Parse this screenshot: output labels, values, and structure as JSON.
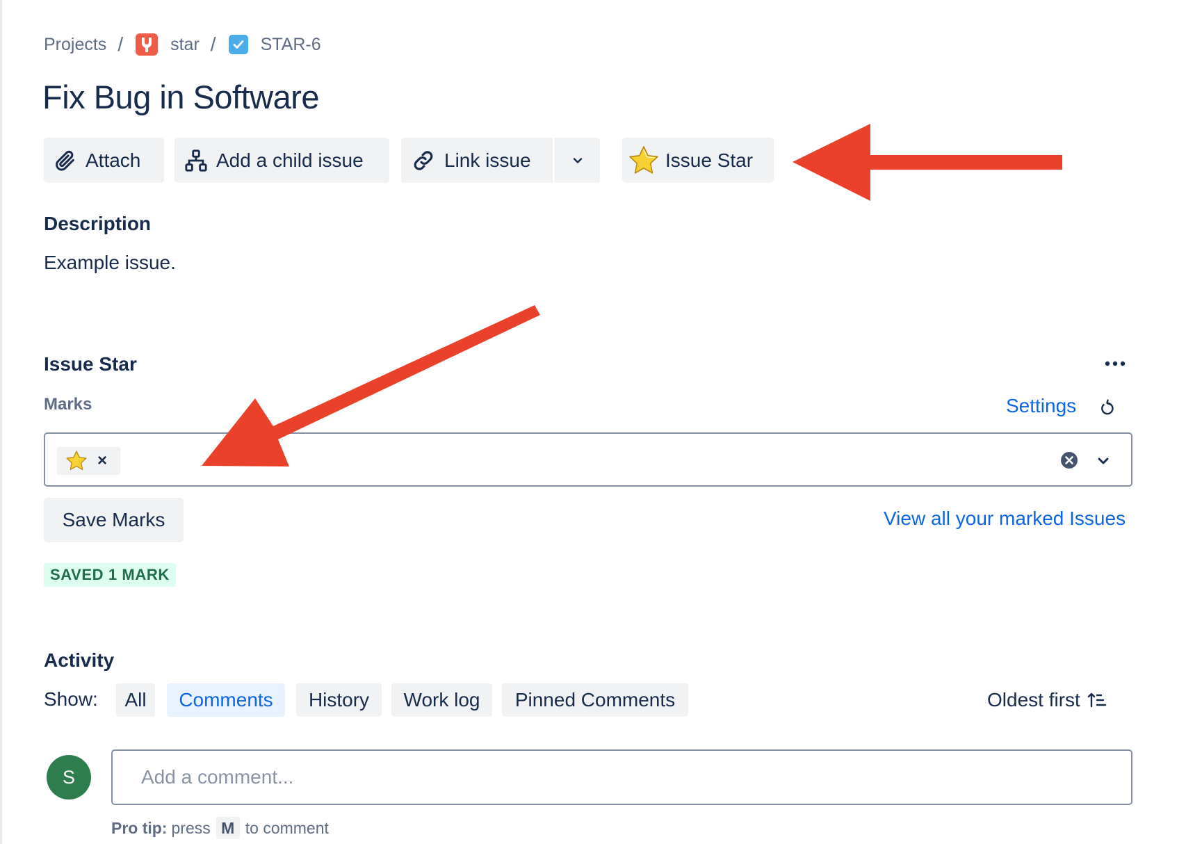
{
  "breadcrumb": {
    "projects": "Projects",
    "separator": "/",
    "project": "star",
    "issue_key": "STAR-6"
  },
  "issue": {
    "title": "Fix Bug in Software"
  },
  "toolbar": {
    "attach": "Attach",
    "add_child": "Add a child issue",
    "link_issue": "Link issue",
    "issue_star": "Issue Star"
  },
  "description": {
    "heading": "Description",
    "text": "Example issue."
  },
  "issue_star_panel": {
    "heading": "Issue Star",
    "marks_label": "Marks",
    "settings": "Settings",
    "selected_mark_icon": "star-icon",
    "remove_mark": "×",
    "save_button": "Save Marks",
    "view_all_link": "View all your marked Issues",
    "status_badge": "SAVED 1 MARK"
  },
  "activity": {
    "heading": "Activity",
    "show_label": "Show:",
    "filters": [
      "All",
      "Comments",
      "History",
      "Work log",
      "Pinned Comments"
    ],
    "selected_filter": "Comments",
    "sort": "Oldest first"
  },
  "comment": {
    "avatar_initial": "S",
    "placeholder": "Add a comment...",
    "pro_tip_label": "Pro tip:",
    "pro_tip_press": "press",
    "pro_tip_key": "M",
    "pro_tip_suffix": "to comment"
  },
  "colors": {
    "link": "#0c66e4",
    "annotation_arrow": "#e9412a",
    "badge_bg": "#dcfff1",
    "badge_text": "#216e4e",
    "avatar": "#2d7d4d"
  }
}
